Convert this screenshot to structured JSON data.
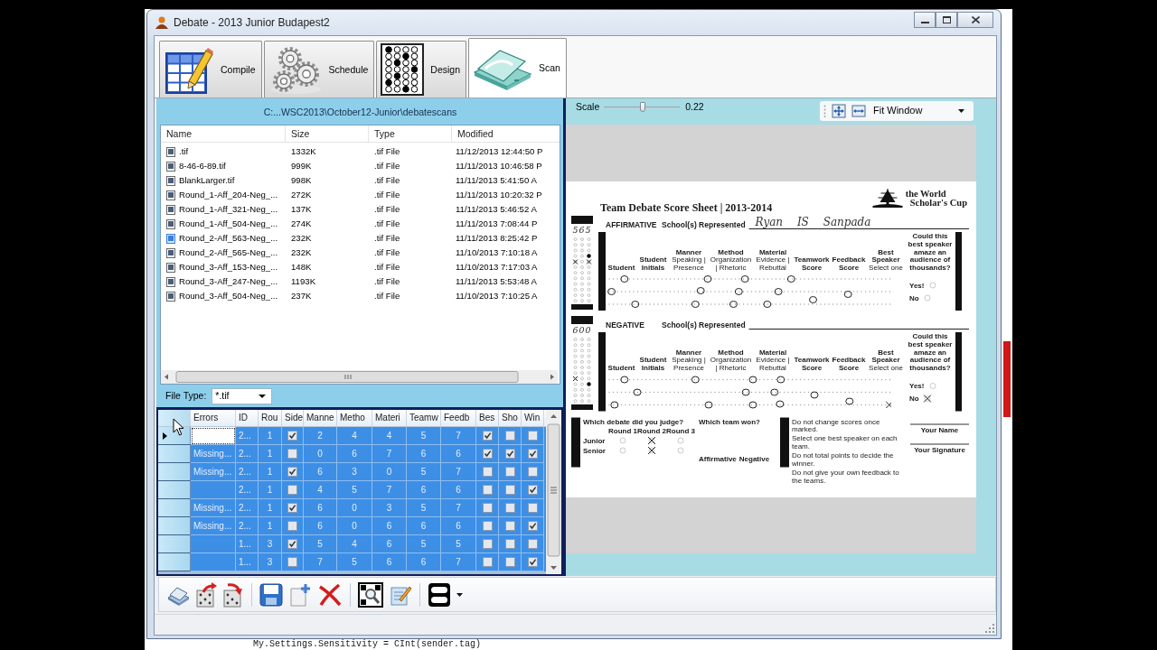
{
  "window": {
    "title": "Debate - 2013 Junior Budapest2"
  },
  "tabs": [
    {
      "label": "Compile",
      "selected": false
    },
    {
      "label": "Schedule",
      "selected": false
    },
    {
      "label": "Design",
      "selected": false
    },
    {
      "label": "Scan",
      "selected": true
    }
  ],
  "file_browser": {
    "path": "C:...WSC2013\\October12-Junior\\debatescans",
    "columns": [
      "Name",
      "Size",
      "Type",
      "Modified"
    ],
    "files": [
      {
        "name": ".tif",
        "size": "1332K",
        "type": ".tif File",
        "modified": "11/12/2013 12:44:50 P",
        "selected": false
      },
      {
        "name": "8-46-6-89.tif",
        "size": "999K",
        "type": ".tif File",
        "modified": "11/11/2013 10:46:58 P",
        "selected": false
      },
      {
        "name": "BlankLarger.tif",
        "size": "998K",
        "type": ".tif File",
        "modified": "11/11/2013 5:41:50 A",
        "selected": false
      },
      {
        "name": "Round_1-Aff_204-Neg_...",
        "size": "272K",
        "type": ".tif File",
        "modified": "11/11/2013 10:20:32 P",
        "selected": false
      },
      {
        "name": "Round_1-Aff_321-Neg_...",
        "size": "137K",
        "type": ".tif File",
        "modified": "11/11/2013 5:46:52 A",
        "selected": false
      },
      {
        "name": "Round_1-Aff_504-Neg_...",
        "size": "274K",
        "type": ".tif File",
        "modified": "11/11/2013 7:08:44 P",
        "selected": false
      },
      {
        "name": "Round_2-Aff_563-Neg_...",
        "size": "232K",
        "type": ".tif File",
        "modified": "11/11/2013 8:25:42 P",
        "selected": true
      },
      {
        "name": "Round_2-Aff_565-Neg_...",
        "size": "232K",
        "type": ".tif File",
        "modified": "11/10/2013 7:10:18 A",
        "selected": false
      },
      {
        "name": "Round_3-Aff_153-Neg_...",
        "size": "148K",
        "type": ".tif File",
        "modified": "11/10/2013 7:17:03 A",
        "selected": false
      },
      {
        "name": "Round_3-Aff_247-Neg_...",
        "size": "1193K",
        "type": ".tif File",
        "modified": "11/11/2013 5:53:48 A",
        "selected": false
      },
      {
        "name": "Round_3-Aff_504-Neg_...",
        "size": "237K",
        "type": ".tif File",
        "modified": "11/10/2013 7:10:25 A",
        "selected": false
      }
    ],
    "file_type": {
      "label": "File Type:",
      "value": "*.tif"
    }
  },
  "grid": {
    "columns": [
      "Errors",
      "ID",
      "Rou",
      "Side",
      "Manne",
      "Metho",
      "Materi",
      "Teamw",
      "Feedb",
      "Bes",
      "Sho",
      "Win"
    ],
    "rows": [
      {
        "current": true,
        "selected": true,
        "id": "2...",
        "round": "1",
        "side": true,
        "manner": "2",
        "method": "4",
        "material": "4",
        "teamwork": "5",
        "feedback": "7",
        "best": true,
        "sho": false,
        "win": false
      },
      {
        "current": false,
        "selected": true,
        "errors": "Missing...",
        "id": "2...",
        "round": "1",
        "side": false,
        "manner": "0",
        "method": "6",
        "material": "7",
        "teamwork": "6",
        "feedback": "6",
        "best": true,
        "sho": true,
        "win": true
      },
      {
        "current": false,
        "selected": true,
        "errors": "Missing...",
        "id": "2...",
        "round": "1",
        "side": true,
        "manner": "6",
        "method": "3",
        "material": "0",
        "teamwork": "5",
        "feedback": "7",
        "best": false,
        "sho": false,
        "win": false
      },
      {
        "current": false,
        "selected": true,
        "id": "2...",
        "round": "1",
        "side": false,
        "manner": "4",
        "method": "5",
        "material": "7",
        "teamwork": "6",
        "feedback": "6",
        "best": false,
        "sho": false,
        "win": true
      },
      {
        "current": false,
        "selected": true,
        "errors": "Missing...",
        "id": "2...",
        "round": "1",
        "side": true,
        "manner": "6",
        "method": "0",
        "material": "3",
        "teamwork": "5",
        "feedback": "7",
        "best": false,
        "sho": false,
        "win": false
      },
      {
        "current": false,
        "selected": true,
        "errors": "Missing...",
        "id": "2...",
        "round": "1",
        "side": false,
        "manner": "6",
        "method": "0",
        "material": "6",
        "teamwork": "6",
        "feedback": "6",
        "best": false,
        "sho": false,
        "win": true
      },
      {
        "current": false,
        "selected": true,
        "id": "1...",
        "round": "3",
        "side": true,
        "manner": "5",
        "method": "4",
        "material": "6",
        "teamwork": "5",
        "feedback": "5",
        "best": false,
        "sho": false,
        "win": false
      },
      {
        "current": false,
        "selected": true,
        "id": "1...",
        "round": "3",
        "side": false,
        "manner": "7",
        "method": "5",
        "material": "6",
        "teamwork": "6",
        "feedback": "7",
        "best": false,
        "sho": false,
        "win": true
      }
    ]
  },
  "viewer": {
    "scale": {
      "label": "Scale",
      "level": 0.51,
      "reading": "0.22"
    },
    "zoom_mode": "Fit Window",
    "sheet": {
      "title": "Team Debate Score Sheet | 2013-2014",
      "logo": [
        "the World",
        "Scholar's Cup"
      ],
      "teams": [
        {
          "heading": "AFFIRMATIVE",
          "school_label": "School(s) Represented",
          "school": "Ryan IS Sanpada",
          "code": "565",
          "columns": [
            {
              "title": "Student"
            },
            {
              "title": "Student Initials"
            },
            {
              "title": "Manner",
              "sub": "Speaking | Presence"
            },
            {
              "title": "Method",
              "sub": "Organization | Rhetoric"
            },
            {
              "title": "Material",
              "sub": "Evidence | Rebuttal"
            },
            {
              "title": "Teamwork Score"
            },
            {
              "title": "Feedback Score"
            },
            {
              "title": "Best Speaker",
              "sub": "Select one"
            },
            {
              "title": "Could this best speaker amaze an audience of thousands?"
            }
          ],
          "answers": [
            {
              "label": "Yes!",
              "marked": false
            },
            {
              "label": "No",
              "marked": false
            }
          ]
        },
        {
          "heading": "NEGATIVE",
          "school_label": "School(s) Represented",
          "code": "600",
          "columns": [
            {
              "title": "Student"
            },
            {
              "title": "Student Initials"
            },
            {
              "title": "Manner",
              "sub": "Speaking | Presence"
            },
            {
              "title": "Method",
              "sub": "Organization | Rhetoric"
            },
            {
              "title": "Material",
              "sub": "Evidence | Rebuttal"
            },
            {
              "title": "Teamwork Score"
            },
            {
              "title": "Feedback Score"
            },
            {
              "title": "Best Speaker",
              "sub": "Select one"
            },
            {
              "title": "Could this best speaker amaze an audience of thousands?"
            }
          ],
          "answers": [
            {
              "label": "Yes!",
              "marked": false
            },
            {
              "label": "No",
              "marked": true
            }
          ]
        }
      ],
      "footer": {
        "judge_question": "Which debate did you judge?",
        "rounds": [
          "Round 1",
          "Round 2",
          "Round 3"
        ],
        "divisions": [
          {
            "label": "Junior",
            "marks": [
              false,
              true,
              false
            ]
          },
          {
            "label": "Senior",
            "marks": [
              false,
              true,
              false
            ]
          }
        ],
        "winner_question": "Which team won?",
        "sides": [
          "Affirmative",
          "Negative"
        ],
        "rules": [
          "Do not change scores once marked.",
          "Select one best speaker on each team.",
          "Do not total points to decide the winner.",
          "Do not give your own feedback to the teams."
        ],
        "signature_labels": [
          "Your Name",
          "Your Signature"
        ]
      }
    }
  },
  "background_editor": {
    "code_line": "My.Settings.Sensitivity = CInt(sender.tag)"
  }
}
